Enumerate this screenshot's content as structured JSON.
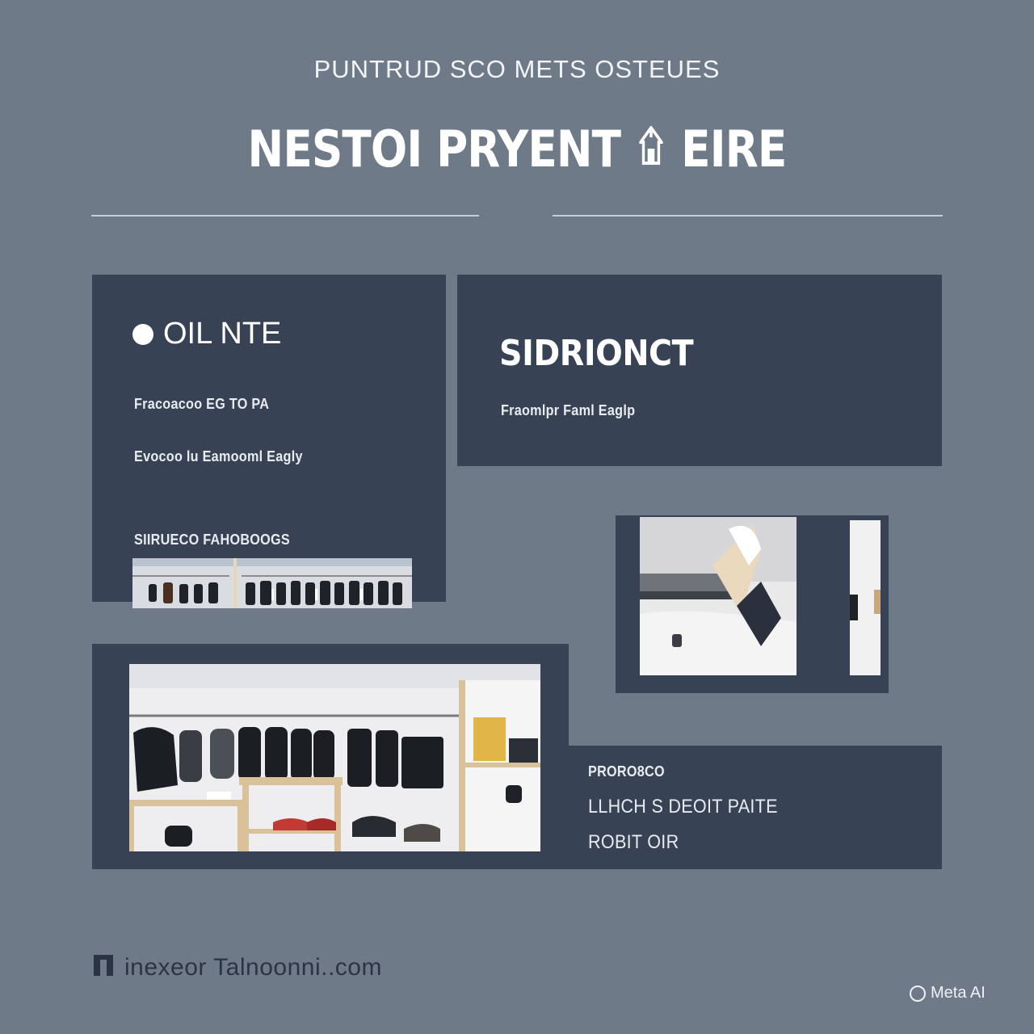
{
  "header": {
    "eyebrow": "PUNTRUD SCO METS OSTEUES",
    "headline_left": "NESTOI  PRYENT",
    "headline_right": "EIRE"
  },
  "panel_left": {
    "title": "OIL NTE",
    "line1": "Fracoacoo EG TO PA",
    "line2": "Evocoo lu Eamooml Eagly",
    "line3": "SIIRUECO FAHOBOOGS"
  },
  "panel_top_right": {
    "title": "SIDRIONCT",
    "subtitle": "Fraomlpr Faml Eaglp"
  },
  "panel_bottom_right": {
    "line1": "PRORO8CO",
    "line2": "LLHCH S DEOIT PAITE",
    "line3": "ROBIT OIR"
  },
  "footer": {
    "brand": "inexeor Talnoonni..com"
  },
  "watermark": {
    "label": "Meta AI"
  },
  "colors": {
    "background": "#6f7a88",
    "panel": "#374355",
    "text": "#ffffff",
    "footer_text": "#2b3444"
  },
  "icons": [
    "house-glyph-icon",
    "storefront-logo-icon",
    "meta-ai-ring-icon"
  ]
}
